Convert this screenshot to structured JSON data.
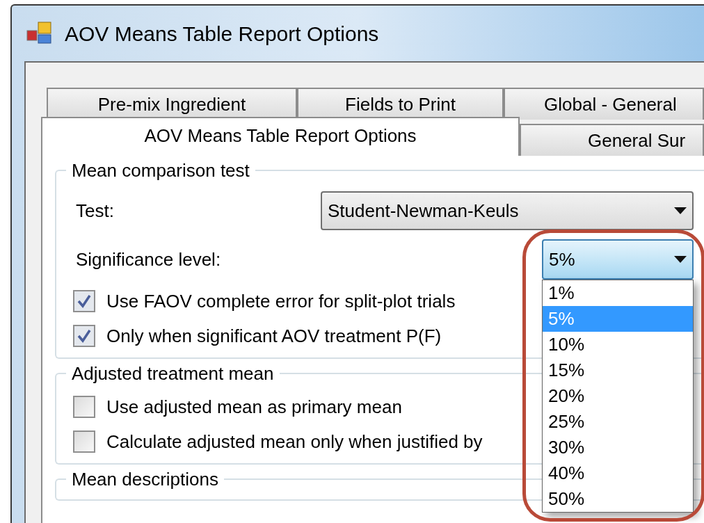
{
  "window": {
    "title": "AOV Means Table Report Options"
  },
  "tab_rows": [
    [
      {
        "label": "Pre-mix Ingredient",
        "selected": false
      },
      {
        "label": "Fields to Print",
        "selected": false
      },
      {
        "label": "Global - General",
        "selected": false
      }
    ],
    [
      {
        "label": "AOV Means Table Report Options",
        "selected": true
      },
      {
        "label": "General Sur",
        "selected": false
      }
    ]
  ],
  "groups": [
    {
      "title": "Mean comparison test",
      "items": [
        {
          "kind": "select",
          "label": "Test:",
          "value": "Student-Newman-Keuls",
          "expanded": false
        },
        {
          "kind": "select",
          "label": "Significance level:",
          "value": "5%",
          "expanded": true,
          "options": [
            {
              "label": "1%",
              "selected": false
            },
            {
              "label": "5%",
              "selected": true
            },
            {
              "label": "10%",
              "selected": false
            },
            {
              "label": "15%",
              "selected": false
            },
            {
              "label": "20%",
              "selected": false
            },
            {
              "label": "25%",
              "selected": false
            },
            {
              "label": "30%",
              "selected": false
            },
            {
              "label": "40%",
              "selected": false
            },
            {
              "label": "50%",
              "selected": false
            }
          ]
        },
        {
          "kind": "checkbox",
          "label": "Use FAOV complete error for split-plot trials",
          "checked": true
        },
        {
          "kind": "checkbox",
          "label": "Only when significant AOV treatment P(F)",
          "checked": true
        }
      ]
    },
    {
      "title": "Adjusted treatment mean",
      "items": [
        {
          "kind": "checkbox",
          "label": "Use adjusted mean as primary mean",
          "checked": false
        },
        {
          "kind": "checkbox",
          "label": "Calculate adjusted mean only when justified by",
          "checked": false
        }
      ]
    },
    {
      "title": "Mean descriptions"
    }
  ]
}
